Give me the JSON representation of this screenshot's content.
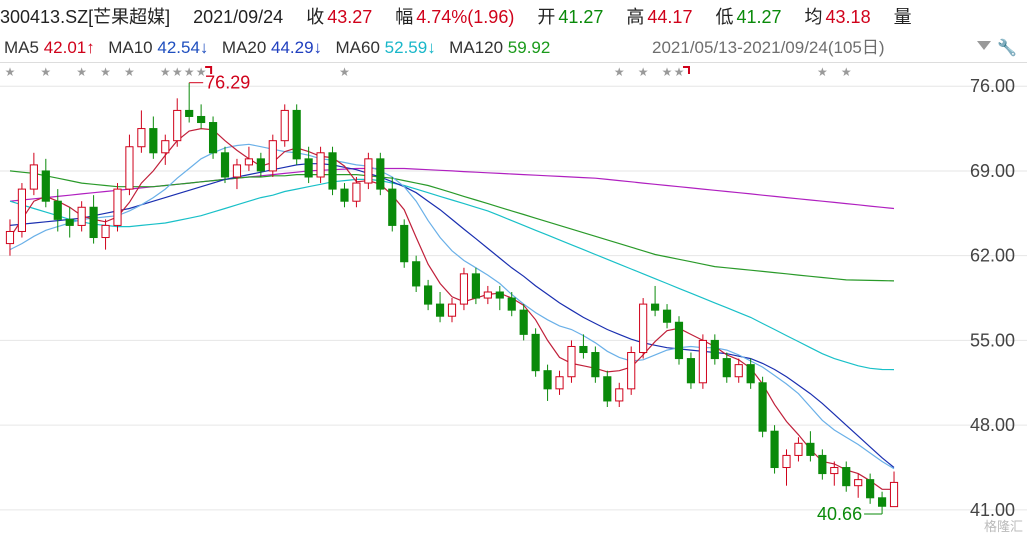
{
  "header": {
    "code": "300413.SZ[芒果超媒]",
    "date": "2021/09/24",
    "close_label": "收",
    "close": "43.27",
    "chg_label": "幅",
    "chg": "4.74%(1.96)",
    "open_label": "开",
    "open": "41.27",
    "high_label": "高",
    "high": "44.17",
    "low_label": "低",
    "low": "41.27",
    "avg_label": "均",
    "avg": "43.18",
    "vol_label": "量"
  },
  "ma_bar": {
    "ma5": {
      "label": "MA5",
      "value": "42.01↑",
      "color": "#d0021b"
    },
    "ma10": {
      "label": "MA10",
      "value": "42.54↓",
      "color": "#1f4fbf"
    },
    "ma20": {
      "label": "MA20",
      "value": "44.29↓",
      "color": "#1f3fbf"
    },
    "ma60": {
      "label": "MA60",
      "value": "52.59↓",
      "color": "#19b7c9"
    },
    "ma120": {
      "label": "MA120",
      "value": "59.92",
      "color": "#1a9a1a"
    },
    "overlap_text": "2021/05/13-2021/09/24(105日)",
    "dropdown_icon": "chevron-down-icon",
    "settings_icon": "wrench-icon"
  },
  "watermark": "格隆汇",
  "chart_data": {
    "type": "candlestick",
    "title": "",
    "y_ticks": [
      "76.00",
      "69.00",
      "62.00",
      "55.00",
      "48.00",
      "41.00"
    ],
    "ylim": [
      40.0,
      78.0
    ],
    "annotations": [
      {
        "text": "76.29",
        "value": 76.29,
        "kind": "high"
      },
      {
        "text": "40.66",
        "value": 40.66,
        "kind": "low"
      }
    ],
    "colors": {
      "up": "#d0021b",
      "down": "#0a8a0a",
      "ma5": "#c0203a",
      "ma10": "#6ab0e8",
      "ma20": "#1a2fb0",
      "ma60": "#19c0c8",
      "ma120": "#2a9a2a",
      "ma250": "#b020c0"
    },
    "candles": [
      [
        63.0,
        65.0,
        62.0,
        64.0
      ],
      [
        64.0,
        68.0,
        63.5,
        67.5
      ],
      [
        67.5,
        70.5,
        67.0,
        69.5
      ],
      [
        69.0,
        70.0,
        66.0,
        66.5
      ],
      [
        66.5,
        67.5,
        64.0,
        65.0
      ],
      [
        65.0,
        66.0,
        63.5,
        64.5
      ],
      [
        64.5,
        66.5,
        64.0,
        66.0
      ],
      [
        66.0,
        67.0,
        63.0,
        63.5
      ],
      [
        63.5,
        65.0,
        62.5,
        64.5
      ],
      [
        64.5,
        68.0,
        64.0,
        67.5
      ],
      [
        67.5,
        72.0,
        67.0,
        71.0
      ],
      [
        71.0,
        74.0,
        70.5,
        72.5
      ],
      [
        72.5,
        73.5,
        70.0,
        70.5
      ],
      [
        70.5,
        72.0,
        69.5,
        71.5
      ],
      [
        71.5,
        75.0,
        71.0,
        74.0
      ],
      [
        74.0,
        76.29,
        73.0,
        73.5
      ],
      [
        73.5,
        74.5,
        72.5,
        73.0
      ],
      [
        73.0,
        73.5,
        70.0,
        70.5
      ],
      [
        70.5,
        71.0,
        68.0,
        68.5
      ],
      [
        68.5,
        70.0,
        67.5,
        69.5
      ],
      [
        69.5,
        71.0,
        69.0,
        70.0
      ],
      [
        70.0,
        70.5,
        68.5,
        69.0
      ],
      [
        69.0,
        72.0,
        68.5,
        71.5
      ],
      [
        71.5,
        74.5,
        71.0,
        74.0
      ],
      [
        74.0,
        74.5,
        69.5,
        70.0
      ],
      [
        70.0,
        71.0,
        68.0,
        68.5
      ],
      [
        68.5,
        71.0,
        68.0,
        70.5
      ],
      [
        70.5,
        71.0,
        67.0,
        67.5
      ],
      [
        67.5,
        68.0,
        66.0,
        66.5
      ],
      [
        66.5,
        68.5,
        66.0,
        68.0
      ],
      [
        68.0,
        70.5,
        67.5,
        70.0
      ],
      [
        70.0,
        70.5,
        67.0,
        67.5
      ],
      [
        67.5,
        68.5,
        64.0,
        64.5
      ],
      [
        64.5,
        65.0,
        61.0,
        61.5
      ],
      [
        61.5,
        62.0,
        59.0,
        59.5
      ],
      [
        59.5,
        60.0,
        57.5,
        58.0
      ],
      [
        58.0,
        59.0,
        56.5,
        57.0
      ],
      [
        57.0,
        58.5,
        56.5,
        58.0
      ],
      [
        58.0,
        61.0,
        57.5,
        60.5
      ],
      [
        60.5,
        61.0,
        58.0,
        58.5
      ],
      [
        58.5,
        59.5,
        58.0,
        59.0
      ],
      [
        59.0,
        59.5,
        57.5,
        58.5
      ],
      [
        58.5,
        59.0,
        57.0,
        57.5
      ],
      [
        57.5,
        58.0,
        55.0,
        55.5
      ],
      [
        55.5,
        56.0,
        52.0,
        52.5
      ],
      [
        52.5,
        53.0,
        50.0,
        51.0
      ],
      [
        51.0,
        52.5,
        50.5,
        52.0
      ],
      [
        52.0,
        55.0,
        51.5,
        54.5
      ],
      [
        54.5,
        55.5,
        53.5,
        54.0
      ],
      [
        54.0,
        54.5,
        51.5,
        52.0
      ],
      [
        52.0,
        52.5,
        49.5,
        50.0
      ],
      [
        50.0,
        51.5,
        49.5,
        51.0
      ],
      [
        51.0,
        54.5,
        50.5,
        54.0
      ],
      [
        54.0,
        58.5,
        53.5,
        58.0
      ],
      [
        58.0,
        59.5,
        57.0,
        57.5
      ],
      [
        57.5,
        58.0,
        56.0,
        56.5
      ],
      [
        56.5,
        57.0,
        53.0,
        53.5
      ],
      [
        53.5,
        54.0,
        51.0,
        51.5
      ],
      [
        51.5,
        55.5,
        51.0,
        55.0
      ],
      [
        55.0,
        55.5,
        53.0,
        53.5
      ],
      [
        53.5,
        54.0,
        51.5,
        52.0
      ],
      [
        52.0,
        53.5,
        51.5,
        53.0
      ],
      [
        53.0,
        53.5,
        51.0,
        51.5
      ],
      [
        51.5,
        52.0,
        47.0,
        47.5
      ],
      [
        47.5,
        48.0,
        44.0,
        44.5
      ],
      [
        44.5,
        46.0,
        43.0,
        45.5
      ],
      [
        45.5,
        47.0,
        45.0,
        46.5
      ],
      [
        46.5,
        47.5,
        45.0,
        45.5
      ],
      [
        45.5,
        46.0,
        43.5,
        44.0
      ],
      [
        44.0,
        45.0,
        43.0,
        44.5
      ],
      [
        44.5,
        45.0,
        42.5,
        43.0
      ],
      [
        43.0,
        44.0,
        42.0,
        43.5
      ],
      [
        43.5,
        44.0,
        41.5,
        42.0
      ],
      [
        42.0,
        42.5,
        40.66,
        41.3
      ],
      [
        41.27,
        44.17,
        41.27,
        43.27
      ]
    ],
    "ma5_values": [
      63.5,
      65.0,
      66.5,
      66.9,
      66.5,
      66.0,
      65.3,
      65.0,
      64.8,
      65.2,
      66.4,
      68.0,
      69.0,
      70.3,
      71.5,
      72.3,
      72.5,
      72.4,
      71.5,
      70.7,
      70.0,
      69.4,
      69.7,
      70.6,
      70.9,
      70.6,
      70.2,
      70.1,
      69.4,
      68.1,
      68.2,
      67.9,
      67.0,
      65.8,
      63.5,
      61.3,
      59.7,
      58.6,
      58.2,
      58.5,
      58.8,
      58.9,
      58.5,
      57.9,
      56.7,
      55.0,
      53.6,
      53.1,
      52.9,
      52.7,
      52.4,
      52.5,
      52.8,
      53.8,
      54.9,
      55.8,
      56.0,
      55.5,
      55.0,
      54.5,
      53.8,
      53.4,
      52.7,
      51.4,
      49.7,
      48.3,
      47.2,
      46.0,
      45.0,
      44.8,
      44.3,
      44.0,
      43.4,
      42.7,
      42.7
    ],
    "ma10_values": [
      62.5,
      63.0,
      63.6,
      64.1,
      64.4,
      64.7,
      65.0,
      65.1,
      65.2,
      65.3,
      65.7,
      66.2,
      66.8,
      67.5,
      68.4,
      69.2,
      70.0,
      70.5,
      70.9,
      71.1,
      71.2,
      71.0,
      70.8,
      70.6,
      70.5,
      70.3,
      70.0,
      69.9,
      69.7,
      69.5,
      69.4,
      69.0,
      68.5,
      67.7,
      66.5,
      64.9,
      63.5,
      62.4,
      61.6,
      61.0,
      60.4,
      59.7,
      58.8,
      58.0,
      57.3,
      56.7,
      56.2,
      55.9,
      55.4,
      54.8,
      54.1,
      53.6,
      53.3,
      53.4,
      53.8,
      54.2,
      54.4,
      54.5,
      54.4,
      54.4,
      54.2,
      53.8,
      53.3,
      52.8,
      52.1,
      51.4,
      50.6,
      49.5,
      48.4,
      47.6,
      47.0,
      46.4,
      45.7,
      45.0,
      44.4
    ],
    "ma20_values": [
      64.5,
      64.6,
      64.7,
      64.8,
      64.9,
      65.0,
      65.1,
      65.3,
      65.5,
      65.7,
      65.9,
      66.2,
      66.5,
      66.8,
      67.1,
      67.4,
      67.7,
      68.0,
      68.3,
      68.5,
      68.7,
      68.9,
      69.1,
      69.3,
      69.5,
      69.6,
      69.6,
      69.5,
      69.3,
      69.1,
      68.8,
      68.5,
      68.1,
      67.7,
      67.2,
      66.5,
      65.8,
      65.0,
      64.2,
      63.4,
      62.6,
      61.8,
      61.0,
      60.3,
      59.5,
      58.8,
      58.1,
      57.5,
      56.9,
      56.4,
      55.9,
      55.5,
      55.1,
      54.8,
      54.6,
      54.4,
      54.3,
      54.2,
      54.1,
      54.0,
      53.9,
      53.7,
      53.5,
      53.1,
      52.6,
      52.0,
      51.3,
      50.6,
      49.8,
      48.9,
      48.0,
      47.1,
      46.2,
      45.3,
      44.5
    ],
    "ma60_values": [
      66.5,
      66.2,
      65.9,
      65.6,
      65.3,
      65.0,
      64.8,
      64.6,
      64.5,
      64.4,
      64.4,
      64.5,
      64.6,
      64.7,
      64.9,
      65.1,
      65.3,
      65.6,
      65.9,
      66.2,
      66.5,
      66.8,
      67.0,
      67.3,
      67.5,
      67.7,
      67.9,
      68.1,
      68.2,
      68.3,
      68.3,
      68.2,
      68.0,
      67.8,
      67.5,
      67.2,
      66.9,
      66.6,
      66.3,
      66.0,
      65.7,
      65.3,
      64.9,
      64.5,
      64.1,
      63.7,
      63.3,
      62.9,
      62.5,
      62.1,
      61.7,
      61.3,
      60.9,
      60.5,
      60.1,
      59.7,
      59.3,
      58.9,
      58.5,
      58.1,
      57.7,
      57.3,
      56.9,
      56.4,
      55.9,
      55.4,
      54.9,
      54.4,
      53.9,
      53.5,
      53.2,
      52.9,
      52.7,
      52.6,
      52.59
    ],
    "ma120_values": [
      69.0,
      68.9,
      68.8,
      68.6,
      68.4,
      68.2,
      68.0,
      67.9,
      67.8,
      67.7,
      67.7,
      67.7,
      67.7,
      67.8,
      67.9,
      68.0,
      68.1,
      68.2,
      68.3,
      68.4,
      68.5,
      68.5,
      68.6,
      68.6,
      68.7,
      68.7,
      68.7,
      68.7,
      68.7,
      68.7,
      68.6,
      68.5,
      68.4,
      68.2,
      68.0,
      67.8,
      67.5,
      67.2,
      66.9,
      66.6,
      66.3,
      66.0,
      65.7,
      65.4,
      65.1,
      64.8,
      64.5,
      64.2,
      63.9,
      63.6,
      63.3,
      63.0,
      62.7,
      62.4,
      62.1,
      61.9,
      61.7,
      61.5,
      61.3,
      61.1,
      61.0,
      60.9,
      60.8,
      60.7,
      60.6,
      60.5,
      60.4,
      60.3,
      60.2,
      60.1,
      60.0,
      59.98,
      59.96,
      59.94,
      59.92
    ],
    "ma250_values": [
      66.5,
      66.6,
      66.7,
      66.8,
      66.9,
      67.0,
      67.1,
      67.2,
      67.3,
      67.4,
      67.5,
      67.6,
      67.7,
      67.8,
      67.9,
      68.0,
      68.1,
      68.2,
      68.3,
      68.4,
      68.5,
      68.6,
      68.7,
      68.8,
      68.9,
      69.0,
      69.05,
      69.1,
      69.15,
      69.2,
      69.2,
      69.2,
      69.2,
      69.2,
      69.15,
      69.1,
      69.05,
      69.0,
      68.95,
      68.9,
      68.85,
      68.8,
      68.75,
      68.7,
      68.65,
      68.6,
      68.55,
      68.5,
      68.45,
      68.4,
      68.3,
      68.2,
      68.1,
      68.0,
      67.9,
      67.8,
      67.7,
      67.6,
      67.5,
      67.4,
      67.3,
      67.2,
      67.1,
      67.0,
      66.9,
      66.8,
      66.7,
      66.6,
      66.5,
      66.4,
      66.3,
      66.2,
      66.1,
      66.0,
      65.9
    ],
    "star_indices": [
      0,
      3,
      6,
      8,
      10,
      13,
      14,
      15,
      16,
      28,
      51,
      53,
      55,
      56,
      68,
      70
    ],
    "flag_indices": [
      16,
      56
    ]
  }
}
